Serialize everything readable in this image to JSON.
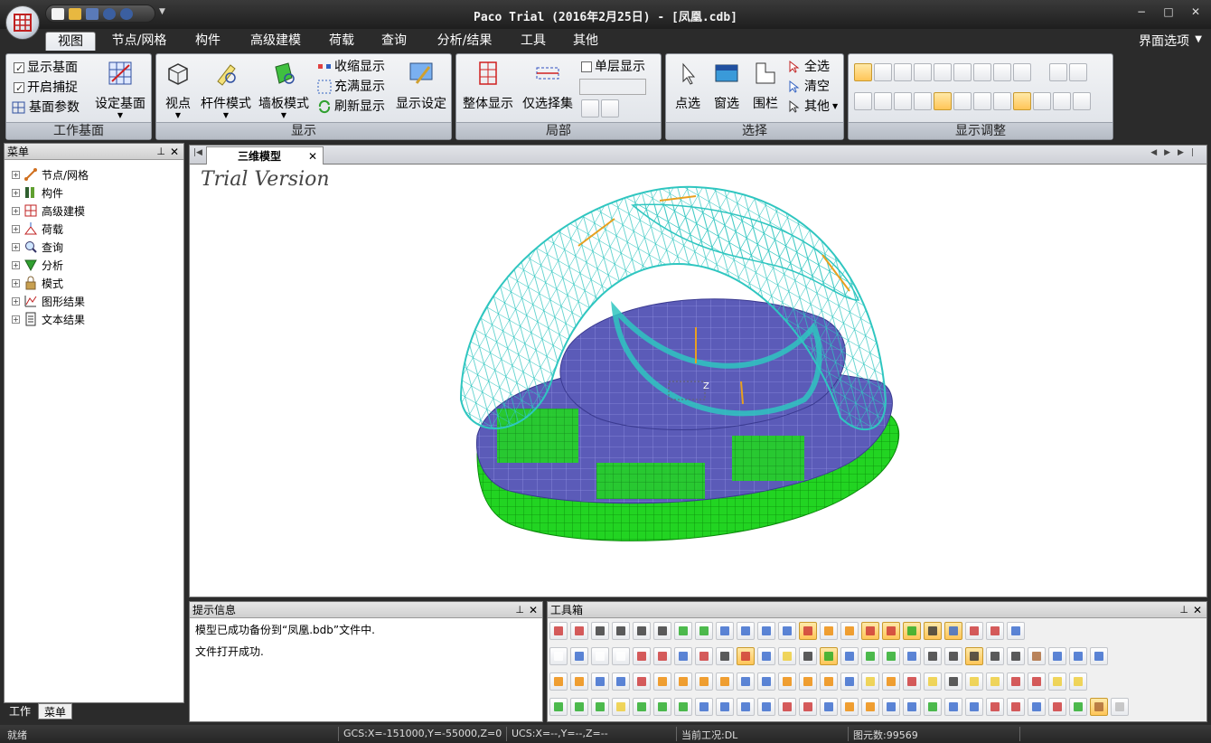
{
  "window": {
    "title": "Paco Trial (2016年2月25日) - [凤凰.cdb]",
    "minimize": "−",
    "maximize": "□",
    "close": "✕"
  },
  "ribbon": {
    "tabs": [
      "视图",
      "节点/网格",
      "构件",
      "高级建模",
      "荷载",
      "查询",
      "分析/结果",
      "工具",
      "其他"
    ],
    "active_tab": "视图",
    "ui_options": "界面选项",
    "groups": {
      "work_plane": {
        "label": "工作基面",
        "show_plane": "显示基面",
        "enable_snap": "开启捕捉",
        "plane_params": "基面参数",
        "set_plane": "设定基面"
      },
      "display": {
        "label": "显示",
        "viewpoint": "视点",
        "member_mode": "杆件模式",
        "wall_mode": "墙板模式",
        "shrink_display": "收缩显示",
        "fill_display": "充满显示",
        "refresh_display": "刷新显示",
        "display_settings": "显示设定"
      },
      "local": {
        "label": "局部",
        "whole_display": "整体显示",
        "select_set_only": "仅选择集",
        "single_layer": "单层显示"
      },
      "select": {
        "label": "选择",
        "point_select": "点选",
        "window_select": "窗选",
        "fence_select": "围栏",
        "select_all": "全选",
        "clear": "清空",
        "other": "其他"
      },
      "display_adjust": {
        "label": "显示调整"
      }
    }
  },
  "left_panel": {
    "title": "菜单",
    "items": [
      "节点/网格",
      "构件",
      "高级建模",
      "荷载",
      "查询",
      "分析",
      "模式",
      "图形结果",
      "文本结果"
    ],
    "bottom_tabs": [
      "工作",
      "菜单"
    ],
    "active_bottom_tab": "菜单"
  },
  "document": {
    "tab": "三维模型",
    "watermark": "Trial Version"
  },
  "messages": {
    "title": "提示信息",
    "lines": [
      "模型已成功备份到“凤凰.bdb”文件中.",
      "文件打开成功."
    ]
  },
  "toolbox": {
    "title": "工具箱"
  },
  "status": {
    "ready": "就绪",
    "gcs": "GCS:X=-151000,Y=-55000,Z=0",
    "ucs": "UCS:X=--,Y=--,Z=--",
    "case": "当前工况:DL",
    "elements": "图元数:99569"
  },
  "colors": {
    "wireframe": "#2fc6c0",
    "slab": "#5b5bb5",
    "wall": "#22cc22",
    "member_highlight": "#e8a020"
  }
}
